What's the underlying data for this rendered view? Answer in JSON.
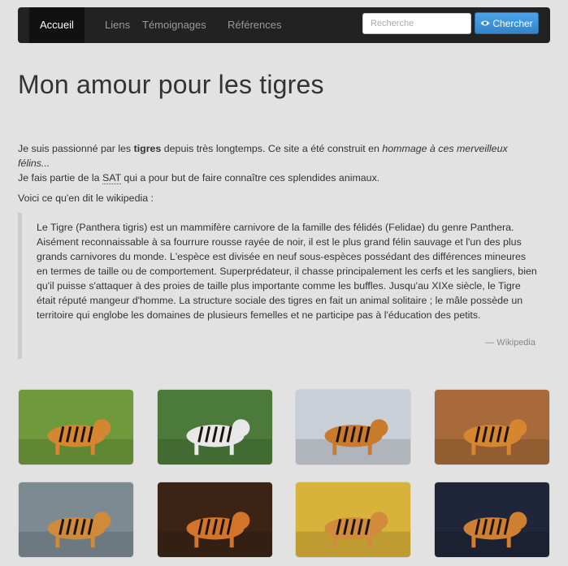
{
  "navbar": {
    "items": [
      {
        "label": "Accueil",
        "active": true
      },
      {
        "label": "Liens"
      },
      {
        "label": "Témoignages"
      },
      {
        "label": "Références"
      }
    ],
    "search": {
      "placeholder": "Recherche",
      "button_label": "Chercher"
    }
  },
  "page": {
    "title": "Mon amour pour les tigres",
    "intro": {
      "p1_pre": "Je suis passionné par les ",
      "p1_bold": "tigres",
      "p1_mid": " depuis très longtemps. Ce site a été construit en ",
      "p1_em": "hommage à ces merveilleux félins...",
      "p2_pre": "Je fais partie de la ",
      "p2_abbr": "SAT",
      "p2_post": " qui a pour but de faire connaître ces splendides animaux."
    },
    "wiki_lead": "Voici ce qu'en dit le wikipedia :",
    "quote": {
      "text": "Le Tigre (Panthera tigris) est un mammifère carnivore de la famille des félidés (Felidae) du genre Panthera. Aisément reconnaissable à sa fourrure rousse rayée de noir, il est le plus grand félin sauvage et l'un des plus grands carnivores du monde. L'espèce est divisée en neuf sous-espèces possédant des différences mineures en termes de taille ou de comportement. Superprédateur, il chasse principalement les cerfs et les sangliers, bien qu'il puisse s'attaquer à des proies de taille plus importante comme les buffles. Jusqu'au XIXe siècle, le Tigre était réputé mangeur d'homme. La structure sociale des tigres en fait un animal solitaire ; le mâle possède un territoire qui englobe les domaines de plusieurs femelles et ne participe pas à l'éducation des petits.",
      "source": "— Wikipedia"
    }
  },
  "gallery": [
    {
      "name": "tiger-lying-grass",
      "bg": "#6e9a3c",
      "tiger": "#d68630"
    },
    {
      "name": "white-tiger-walking",
      "bg": "#4c7a3a",
      "tiger": "#e8e8e8"
    },
    {
      "name": "tiger-snow-prowl",
      "bg": "#c9cfd6",
      "tiger": "#c97a2c"
    },
    {
      "name": "tiger-standing-field",
      "bg": "#a86a3a",
      "tiger": "#d5862f"
    },
    {
      "name": "tiger-on-rocks",
      "bg": "#7c8a92",
      "tiger": "#cf8a3a"
    },
    {
      "name": "tiger-face-closeup",
      "bg": "#3b2416",
      "tiger": "#d4742a"
    },
    {
      "name": "tiger-cub-flowers",
      "bg": "#d9b23a",
      "tiger": "#d28a3d"
    },
    {
      "name": "tiger-running-snow",
      "bg": "#20263a",
      "tiger": "#cf7f30"
    }
  ]
}
